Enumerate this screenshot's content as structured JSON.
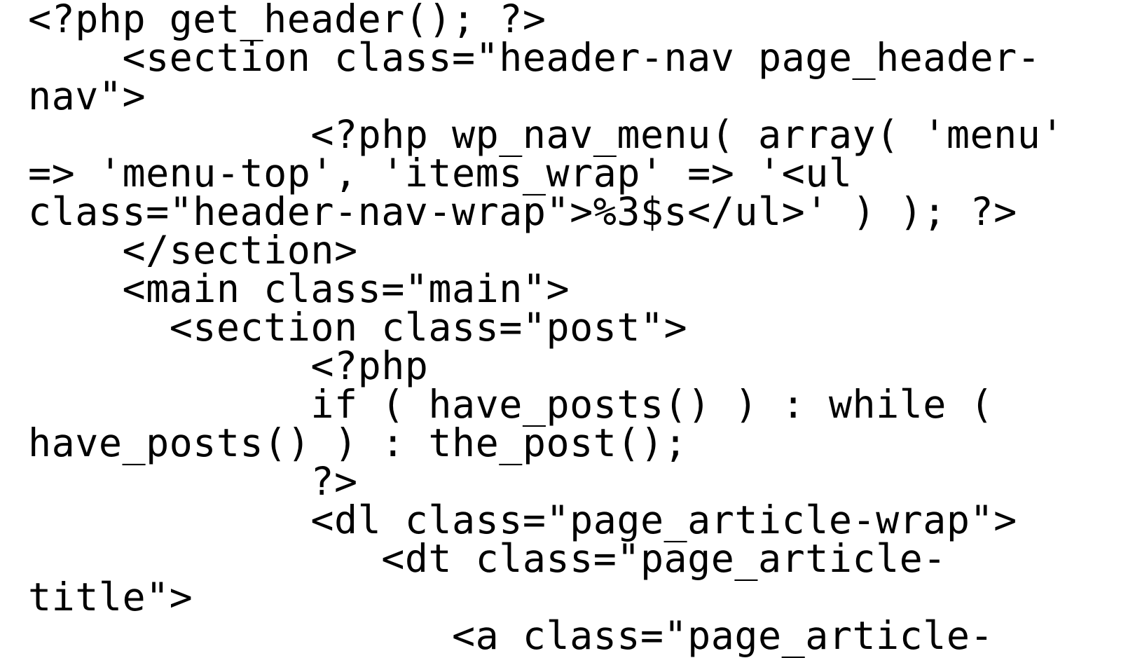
{
  "code": {
    "line1": "<?php get_header(); ?>",
    "line2": "    <section class=\"header-nav page_header-nav\">",
    "line3": "            <?php wp_nav_menu( array( 'menu' => 'menu-top', 'items_wrap' => '<ul class=\"header-nav-wrap\">%3$s</ul>' ) ); ?>",
    "line4": "    </section>",
    "line5": "    <main class=\"main\">",
    "line6": "      <section class=\"post\">",
    "line7": "            <?php",
    "line8": "            if ( have_posts() ) : while ( have_posts() ) : the_post();",
    "line9": "            ?>",
    "line10": "            <dl class=\"page_article-wrap\">",
    "line11": "               <dt class=\"page_article-title\">",
    "line12": "                  <a class=\"page_article-"
  }
}
